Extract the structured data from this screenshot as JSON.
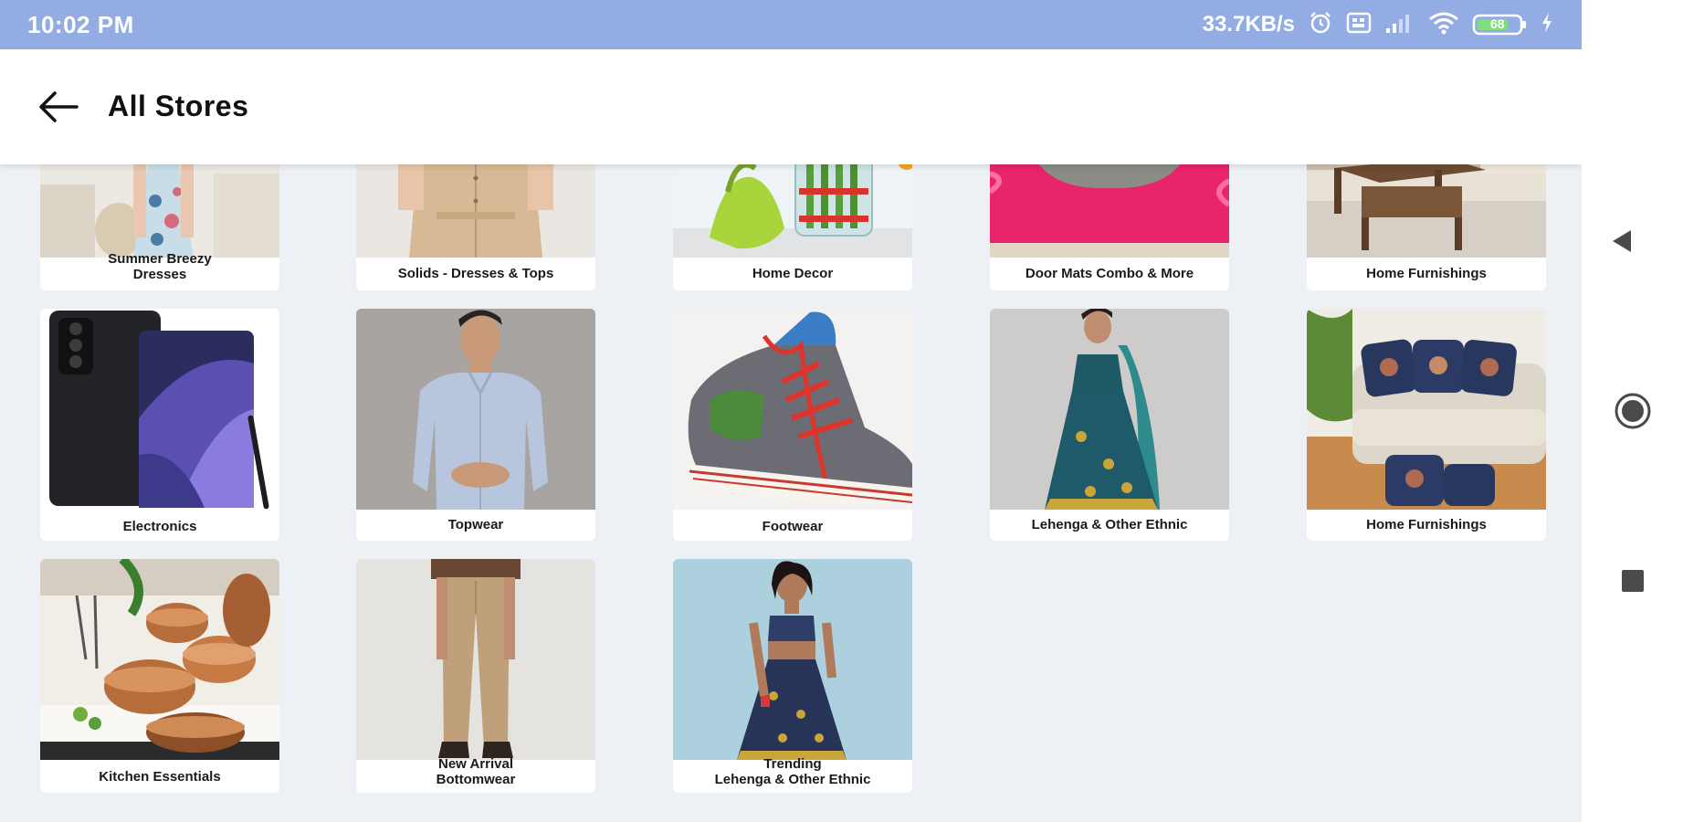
{
  "status_bar": {
    "time": "10:02 PM",
    "net_speed": "33.7KB/s",
    "battery_level": "68",
    "icons": [
      "alarm-icon",
      "data-saver-icon",
      "signal-icon",
      "wifi-icon",
      "battery-icon",
      "charging-icon"
    ]
  },
  "app_bar": {
    "back_icon": "arrow-left-icon",
    "title": "All Stores"
  },
  "stores": [
    {
      "label": "Summer Breezy\nDresses",
      "image": "floral-dress-photo"
    },
    {
      "label": "Solids - Dresses & Tops",
      "image": "beige-dress-photo"
    },
    {
      "label": "Home Decor",
      "image": "vase-decor-photo"
    },
    {
      "label": "Door Mats Combo & More",
      "image": "pink-door-mat-photo"
    },
    {
      "label": "Home Furnishings",
      "image": "coffee-table-photo"
    },
    {
      "label": "Electronics",
      "image": "smartphone-photo"
    },
    {
      "label": "Topwear",
      "image": "man-striped-shirt-photo"
    },
    {
      "label": "Footwear",
      "image": "canvas-sneaker-photo"
    },
    {
      "label": "Lehenga & Other Ethnic",
      "image": "teal-lehenga-photo"
    },
    {
      "label": "Home Furnishings",
      "image": "cushions-sofa-photo"
    },
    {
      "label": "Kitchen Essentials",
      "image": "copper-cookware-photo"
    },
    {
      "label": "New Arrival\nBottomwear",
      "image": "khaki-trousers-photo"
    },
    {
      "label": "Trending\nLehenga & Other Ethnic",
      "image": "navy-lehenga-photo"
    }
  ],
  "system_nav": {
    "back": "triangle-back-icon",
    "home": "circle-home-icon",
    "recents": "square-recents-icon"
  },
  "colors": {
    "status_bar": "#93ace4",
    "background": "#edf1f5",
    "card": "#ffffff",
    "text": "#1a1a1a"
  }
}
